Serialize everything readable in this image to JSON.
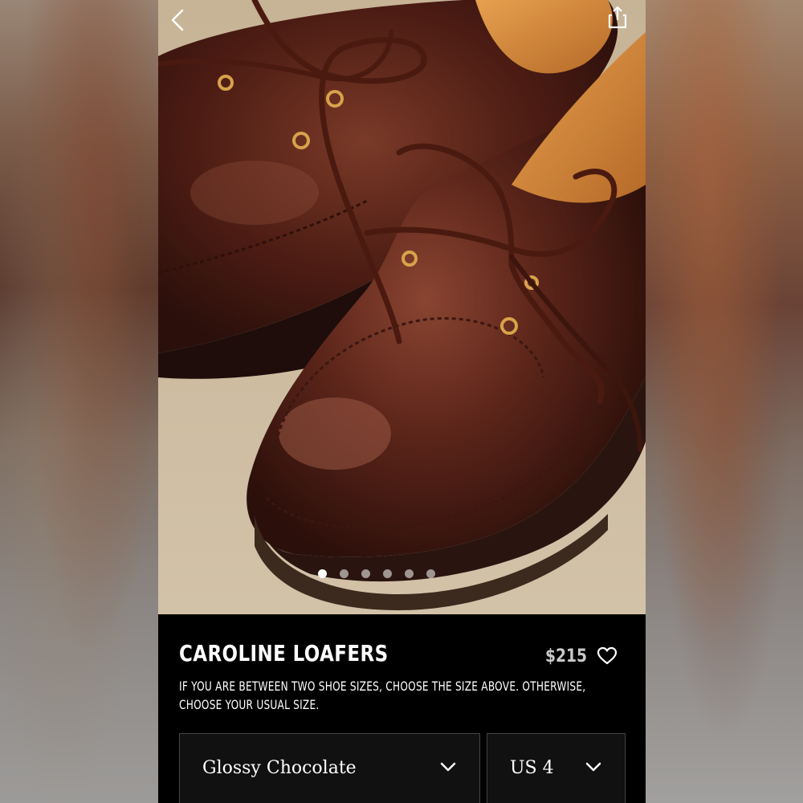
{
  "product": {
    "title": "CAROLINE LOAFERS",
    "price": "$215",
    "size_note": "IF YOU ARE BETWEEN TWO SHOE SIZES, CHOOSE THE SIZE ABOVE. OTHERWISE, CHOOSE YOUR USUAL SIZE."
  },
  "gallery": {
    "image_count": 6,
    "active_index": 0
  },
  "selectors": {
    "color_value": "Glossy Chocolate",
    "size_value": "US 4"
  },
  "icons": {
    "back": "chevron-left-icon",
    "share": "share-icon",
    "favorite": "heart-icon",
    "dropdown": "chevron-down-icon"
  },
  "colors": {
    "info_background": "#000000",
    "text": "#ffffff",
    "price": "#c9c9c9",
    "leather": "#5a2318"
  }
}
